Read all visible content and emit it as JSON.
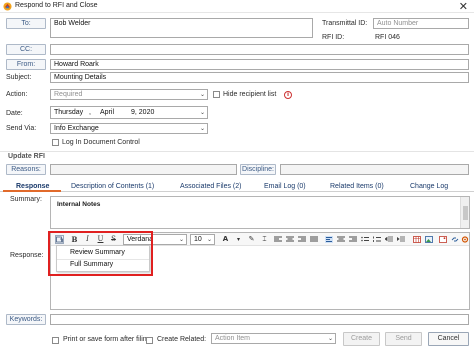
{
  "window": {
    "title": "Respond to RFI and Close",
    "close_glyph": "✕"
  },
  "header": {
    "to_label": "To:",
    "to_value": "Bob Welder",
    "transmittal_label": "Transmittal ID:",
    "transmittal_placeholder": "Auto Number",
    "rfi_id_label": "RFI ID:",
    "rfi_id_value": "RFI 046",
    "cc_label": "CC:",
    "from_label": "From:",
    "from_value": "Howard Roark",
    "subject_label": "Subject:",
    "subject_value": "Mounting Details",
    "action_label": "Action:",
    "action_value": "Required",
    "hide_recipient_label": "Hide recipient list",
    "date_label": "Date:",
    "date_weekday": "Thursday",
    "date_month": "April",
    "date_day_year": "9, 2020",
    "date_sep": ",",
    "send_via_label": "Send Via:",
    "send_via_value": "Info Exchange",
    "log_doc_label": "Log In Document Control"
  },
  "update_rfi": {
    "section_title": "Update RFI",
    "reasons_label": "Reasons:",
    "discipline_label": "Discipline:"
  },
  "tabs": [
    {
      "label": "Response",
      "active": true
    },
    {
      "label": "Description of Contents (1)",
      "active": false
    },
    {
      "label": "Associated Files (2)",
      "active": false
    },
    {
      "label": "Email Log (0)",
      "active": false
    },
    {
      "label": "Related Items (0)",
      "active": false
    },
    {
      "label": "Change Log",
      "active": false
    }
  ],
  "response_tab": {
    "summary_label": "Summary:",
    "summary_text": "Internal Notes",
    "response_label": "Response:",
    "toolbar": {
      "bold": "B",
      "italic": "I",
      "underline": "U",
      "strike": "S",
      "font_family": "Verdana",
      "font_size": "10"
    },
    "template_menu": {
      "items": [
        "Review Summary",
        "Full Summary"
      ]
    }
  },
  "footer": {
    "keywords_label": "Keywords:",
    "print_label": "Print or save form after filing",
    "create_related_label": "Create Related:",
    "create_related_value": "Action Item",
    "create_button": "Create",
    "send_button": "Send",
    "cancel_button": "Cancel"
  },
  "colors": {
    "accent_tab": "#e16a2b",
    "highlight_box": "#e02020",
    "link_blue": "#1a3a6b",
    "info_icon": "#cc3333"
  }
}
